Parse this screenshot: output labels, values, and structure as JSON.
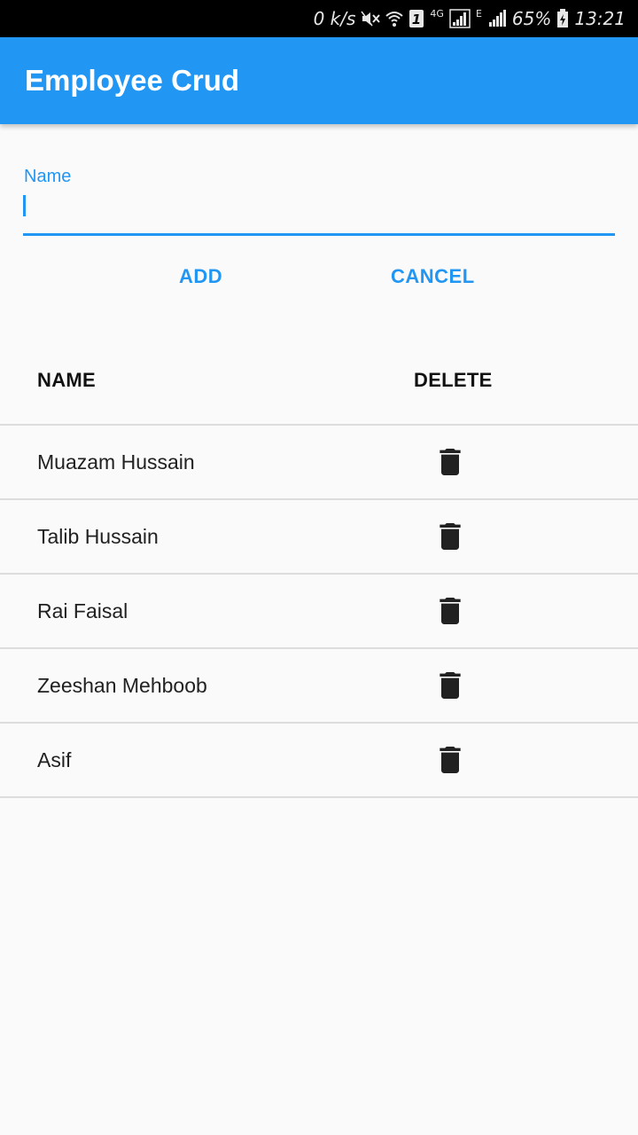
{
  "status_bar": {
    "speed": "0 k/s",
    "sim_slot": "1",
    "network_4g": "4G",
    "network_e": "E",
    "battery": "65%",
    "time": "13:21",
    "icons": [
      "mute-icon",
      "wifi-icon",
      "sim-icon",
      "signal-icon",
      "signal-icon",
      "battery-charging-icon"
    ]
  },
  "app_bar": {
    "title": "Employee Crud",
    "color": "#2196f3"
  },
  "form": {
    "name_label": "Name",
    "name_value": "",
    "add_label": "ADD",
    "cancel_label": "CANCEL"
  },
  "table": {
    "columns": [
      "NAME",
      "DELETE"
    ],
    "rows": [
      {
        "name": "Muazam Hussain",
        "action_icon": "trash-icon"
      },
      {
        "name": "Talib Hussain",
        "action_icon": "trash-icon"
      },
      {
        "name": "Rai Faisal",
        "action_icon": "trash-icon"
      },
      {
        "name": "Zeeshan Mehboob",
        "action_icon": "trash-icon"
      },
      {
        "name": "Asif",
        "action_icon": "trash-icon"
      }
    ]
  },
  "colors": {
    "accent": "#2196f3",
    "background": "#fafafa",
    "text": "#212121",
    "divider": "#dddddd"
  }
}
